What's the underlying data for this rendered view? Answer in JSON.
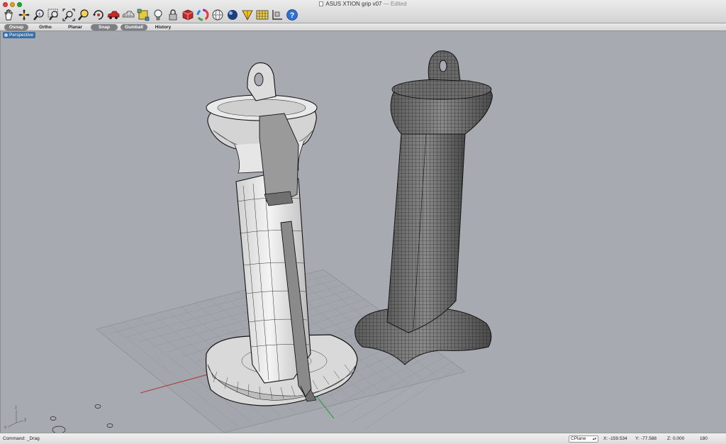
{
  "window": {
    "title": "ASUS XTION grip v07",
    "separator": " — ",
    "status": "Edited"
  },
  "toolbar": {
    "icons": [
      "pan-hand-icon",
      "move-icon",
      "zoom-icon",
      "zoom-window-icon",
      "zoom-extents-icon",
      "zoom-selected-icon",
      "rotate-view-icon",
      "car-icon",
      "wireframe-car-icon",
      "snapshot-icon",
      "light-bulb-icon",
      "lock-icon",
      "cube-icon",
      "color-wheel-icon",
      "sphere-wire-icon",
      "render-sphere-icon",
      "cone-tool-icon",
      "grid-icon",
      "cplane-icon",
      "help-icon"
    ]
  },
  "modebar": {
    "osnap": "Osnap",
    "ortho": "Ortho",
    "planar": "Planar",
    "snap": "Snap",
    "gumball": "Gumball",
    "history": "History"
  },
  "viewport": {
    "name": "Perspective",
    "background": "#a7abb1",
    "axis_labels": {
      "x": "x",
      "y": "y",
      "z": "z"
    }
  },
  "status": {
    "command_label": "Command:",
    "command_value": "_Drag",
    "cplane": "CPlane",
    "x_label": "X:",
    "x_value": "-159.534",
    "y_label": "Y:",
    "y_value": "-77.588",
    "z_label": "Z:",
    "z_value": "0.000",
    "readout": "180"
  },
  "colors": {
    "accent": "#3b6ea5",
    "x_axis": "#b03a36",
    "y_axis": "#2f9a3f"
  }
}
